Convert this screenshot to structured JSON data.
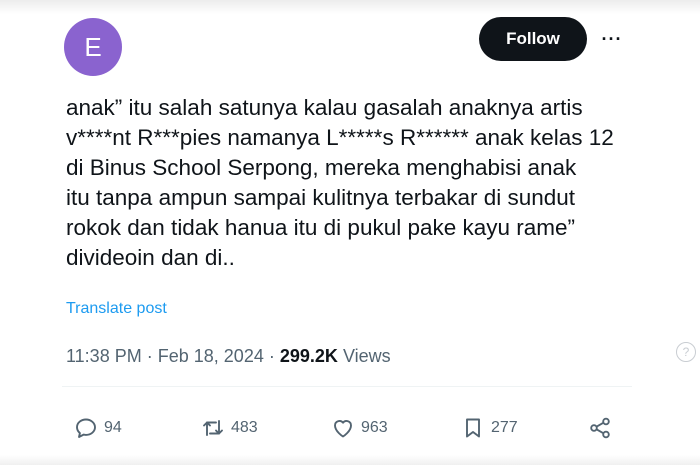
{
  "user": {
    "avatar_letter": "E",
    "avatar_color": "#8a63cf"
  },
  "header": {
    "follow_label": "Follow",
    "more_label": "···"
  },
  "post": {
    "lines": [
      "anak” itu salah satunya kalau gasalah anaknya artis",
      "v****nt R***pies namanya L*****s R****** anak kelas 12",
      "di Binus School Serpong, mereka menghabisi anak",
      "itu tanpa ampun sampai kulitnya terbakar di sundut",
      "rokok dan tidak hanua itu di pukul pake kayu rame”",
      "divideoin dan di.."
    ],
    "translate_label": "Translate post"
  },
  "meta": {
    "time": "11:38 PM",
    "sep1": "·",
    "date": "Feb 18, 2024",
    "sep2": "·",
    "views_count": "299.2K",
    "views_label": "Views"
  },
  "actions": {
    "replies": "94",
    "reposts": "483",
    "likes": "963",
    "bookmarks": "277"
  },
  "colors": {
    "accent": "#1d9bf0",
    "text": "#0f1419",
    "secondary": "#536471"
  }
}
